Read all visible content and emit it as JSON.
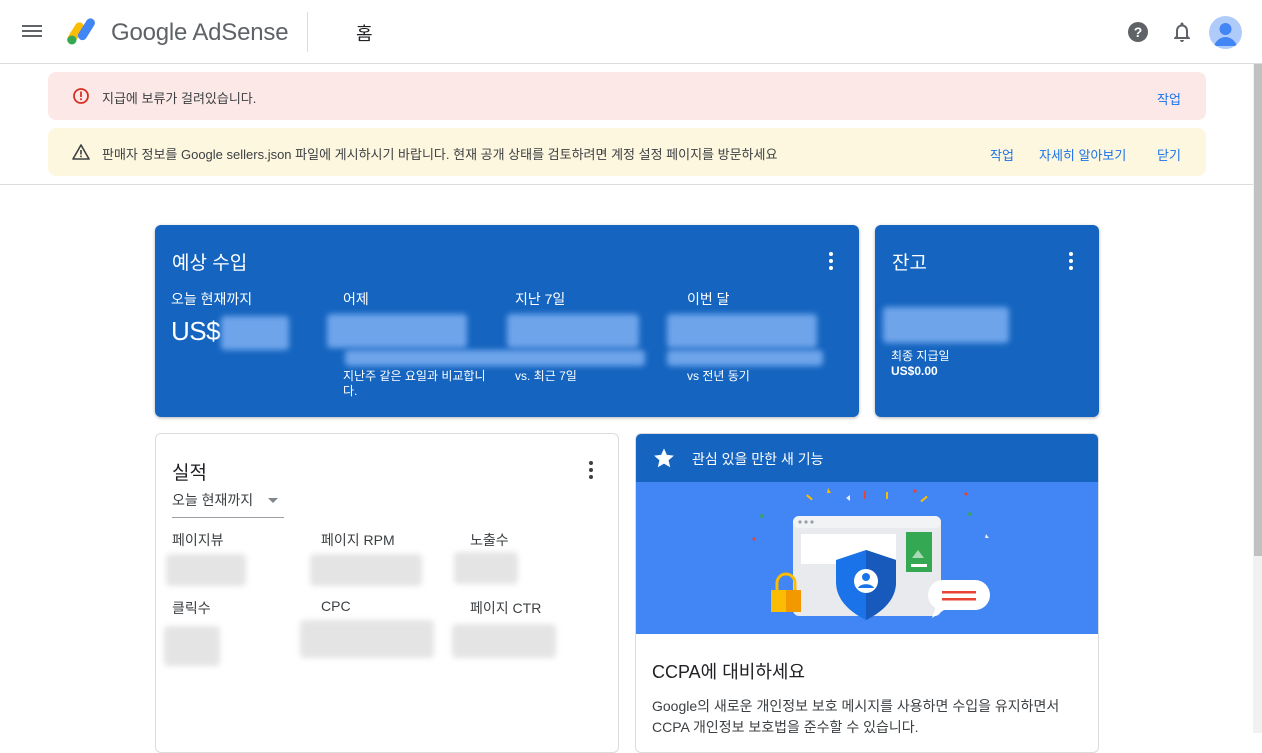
{
  "header": {
    "product_name": "Google AdSense",
    "page_title": "홈"
  },
  "banners": {
    "error": {
      "text": "지급에 보류가 걸려있습니다.",
      "action": "작업"
    },
    "warning": {
      "text": "판매자 정보를 Google sellers.json 파일에 게시하시기 바랍니다. 현재 공개 상태를 검토하려면 계정 설정 페이지를 방문하세요",
      "action": "작업",
      "learn_more": "자세히 알아보기",
      "close": "닫기"
    }
  },
  "estimated_earnings": {
    "title": "예상 수입",
    "columns": [
      {
        "label": "오늘 현재까지",
        "value_prefix": "US$"
      },
      {
        "label": "어제",
        "comparison": "지난주 같은 요일과 비교합니다."
      },
      {
        "label": "지난 7일",
        "comparison": "vs. 최근 7일"
      },
      {
        "label": "이번 달",
        "comparison": "vs 전년 동기"
      }
    ]
  },
  "balance": {
    "title": "잔고",
    "last_payment_label": "최종 지급일",
    "last_payment_value": "US$0.00"
  },
  "performance": {
    "title": "실적",
    "range": "오늘 현재까지",
    "metrics": [
      "페이지뷰",
      "페이지 RPM",
      "노출수",
      "클릭수",
      "CPC",
      "페이지 CTR"
    ]
  },
  "feature": {
    "header": "관심 있을 만한 새 기능",
    "title": "CCPA에 대비하세요",
    "body": "Google의 새로운 개인정보 보호 메시지를 사용하면 수입을 유지하면서 CCPA 개인정보 보호법을 준수할 수 있습니다."
  },
  "icons": {
    "menu": "menu-icon",
    "help": "help-icon",
    "notifications": "bell-icon",
    "error": "error-icon",
    "warning": "warning-icon",
    "more": "more-vert-icon",
    "star": "star-icon"
  },
  "colors": {
    "primary": "#1565c0",
    "link": "#1a73e8",
    "error_bg": "#fce8e6",
    "warning_bg": "#fef7e0"
  }
}
